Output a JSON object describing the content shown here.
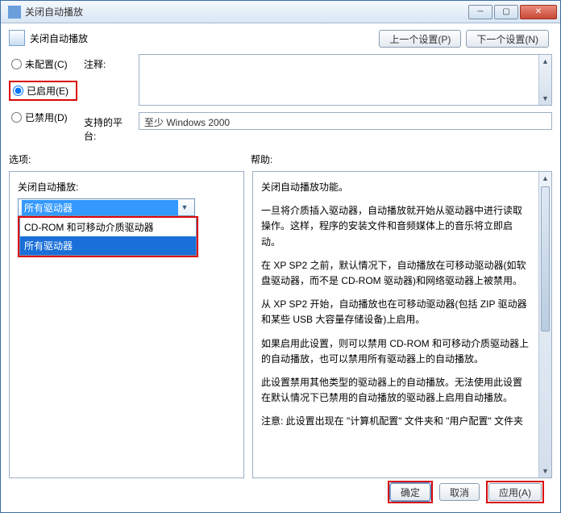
{
  "window": {
    "title": "关闭自动播放"
  },
  "dialog": {
    "title": "关闭自动播放",
    "nav_prev": "上一个设置(P)",
    "nav_next": "下一个设置(N)"
  },
  "radios": {
    "unconfigured": "未配置(C)",
    "enabled": "已启用(E)",
    "disabled": "已禁用(D)"
  },
  "form": {
    "comment_label": "注释:",
    "platform_label": "支持的平台:",
    "platform_value": "至少 Windows 2000"
  },
  "sections": {
    "options": "选项:",
    "help": "帮助:"
  },
  "options": {
    "label": "关闭自动播放:",
    "selected": "所有驱动器",
    "items": [
      "CD-ROM 和可移动介质驱动器",
      "所有驱动器"
    ]
  },
  "help": {
    "p1": "关闭自动播放功能。",
    "p2": "一旦将介质插入驱动器，自动播放就开始从驱动器中进行读取操作。这样，程序的安装文件和音频媒体上的音乐将立即启动。",
    "p3": "在 XP SP2 之前，默认情况下，自动播放在可移动驱动器(如软盘驱动器，而不是 CD-ROM 驱动器)和网络驱动器上被禁用。",
    "p4": "从 XP SP2 开始，自动播放也在可移动驱动器(包括 ZIP 驱动器和某些 USB 大容量存储设备)上启用。",
    "p5": "如果启用此设置，则可以禁用 CD-ROM 和可移动介质驱动器上的自动播放，也可以禁用所有驱动器上的自动播放。",
    "p6": "此设置禁用其他类型的驱动器上的自动播放。无法使用此设置在默认情况下已禁用的自动播放的驱动器上启用自动播放。",
    "p7": "注意: 此设置出现在 \"计算机配置\" 文件夹和 \"用户配置\" 文件夹"
  },
  "footer": {
    "ok": "确定",
    "cancel": "取消",
    "apply": "应用(A)"
  }
}
